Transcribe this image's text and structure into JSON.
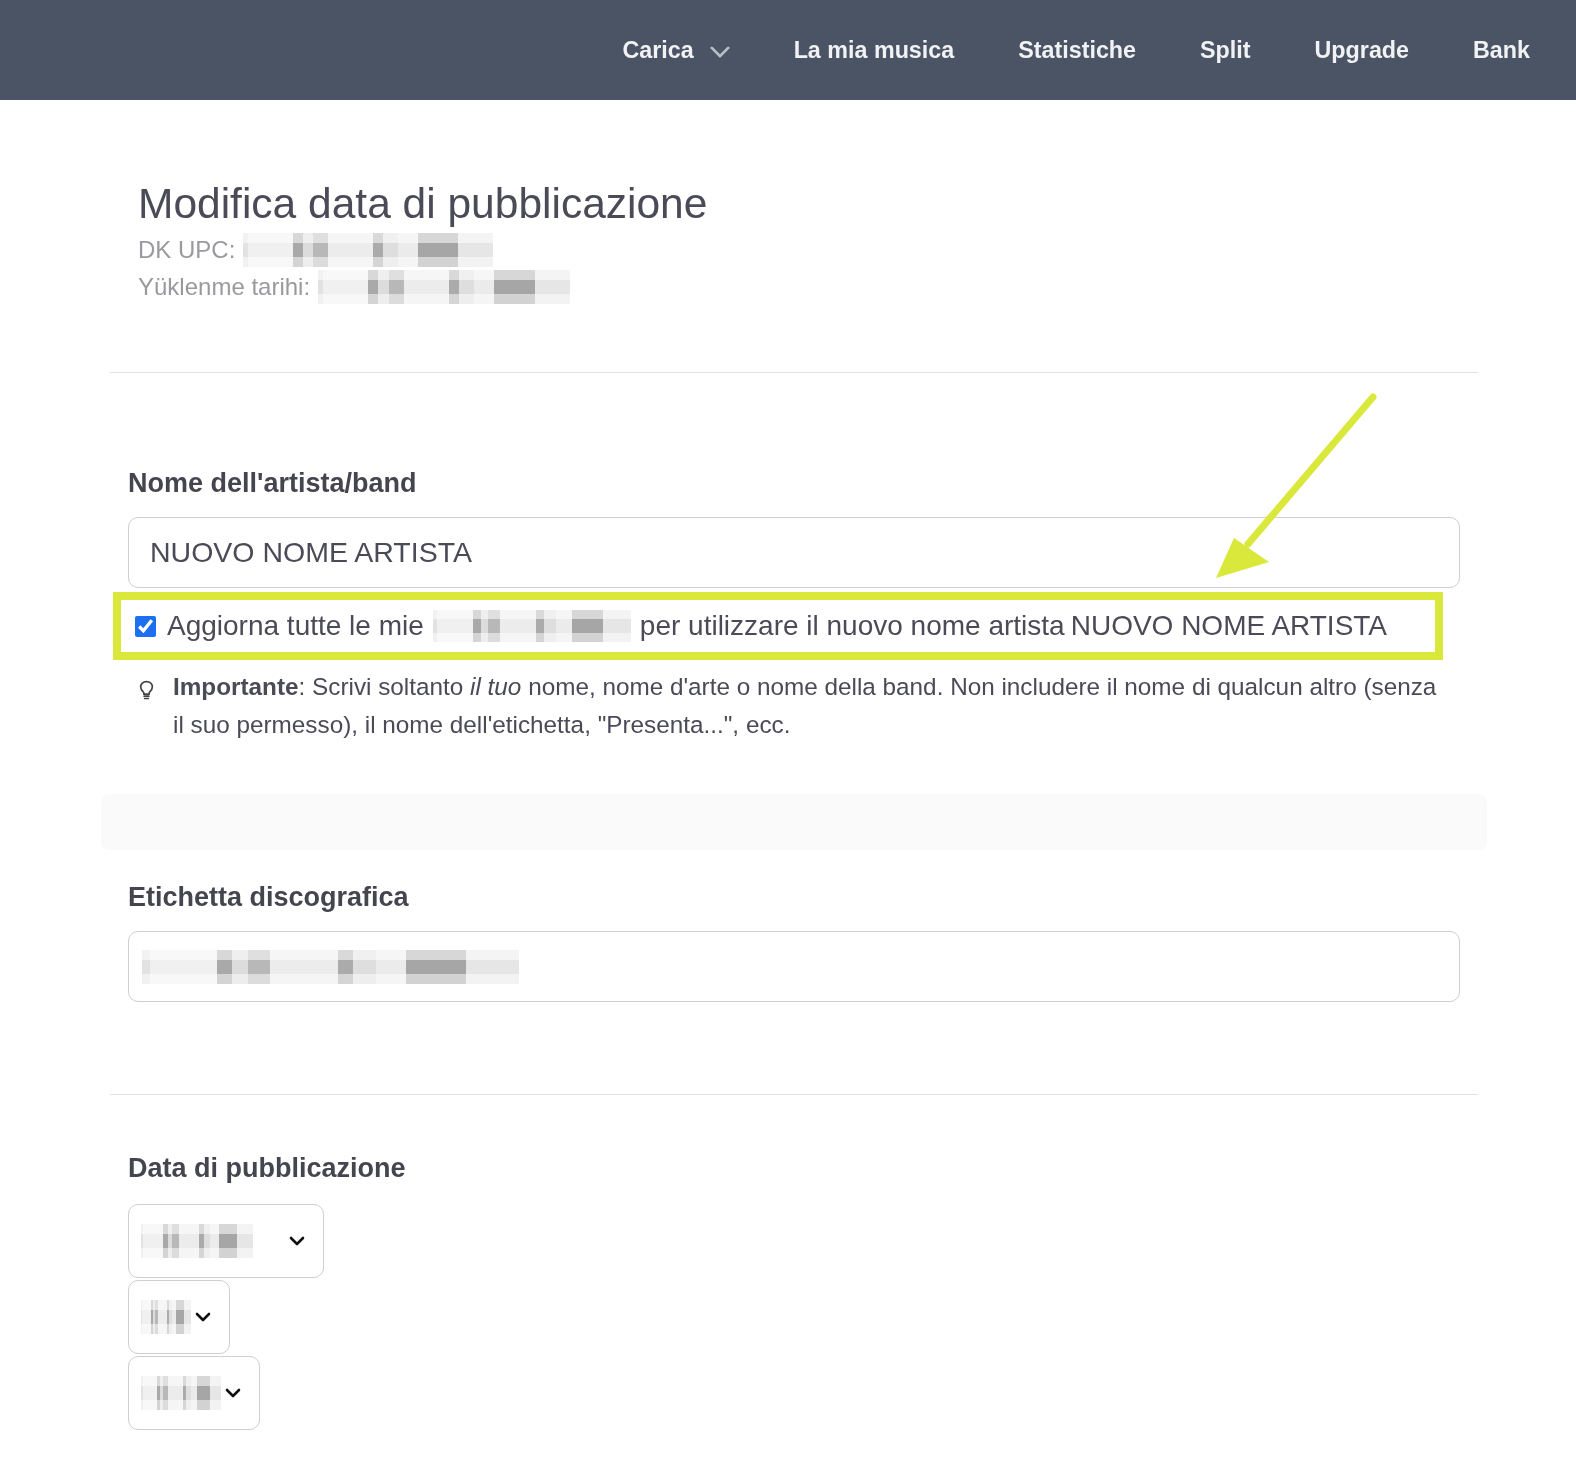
{
  "nav": {
    "items": [
      {
        "label": "Carica",
        "dropdown": true
      },
      {
        "label": "La mia musica",
        "dropdown": false
      },
      {
        "label": "Statistiche",
        "dropdown": false
      },
      {
        "label": "Split",
        "dropdown": false
      },
      {
        "label": "Upgrade",
        "dropdown": false
      },
      {
        "label": "Bank",
        "dropdown": false
      }
    ]
  },
  "header": {
    "title": "Modifica data di pubblicazione",
    "meta": [
      {
        "label": "DK UPC:",
        "redacted": true
      },
      {
        "label": "Yüklenme tarihi:",
        "redacted": true
      }
    ]
  },
  "artist": {
    "label": "Nome dell'artista/band",
    "value": "NUOVO NOME ARTISTA",
    "update_all": {
      "checked": true,
      "highlighted": true,
      "text_before": "Aggiorna tutte le mie",
      "redacted": true,
      "text_after": "per utilizzare il nuovo nome artista",
      "artist_name": "NUOVO NOME ARTISTA"
    },
    "hint": "**Importante**: Scrivi soltanto *il tuo* nome, nome d'arte o nome della band. Non includere il nome di qualcun altro (senza il suo permesso), il nome dell'etichetta, \"Presenta...\", ecc."
  },
  "record_label": {
    "label": "Etichetta discografica",
    "redacted": true
  },
  "release_date": {
    "label": "Data di pubblicazione",
    "selects": [
      {
        "redacted": true
      },
      {
        "redacted": true
      },
      {
        "redacted": true
      }
    ]
  },
  "annotation": {
    "arrow": true
  }
}
